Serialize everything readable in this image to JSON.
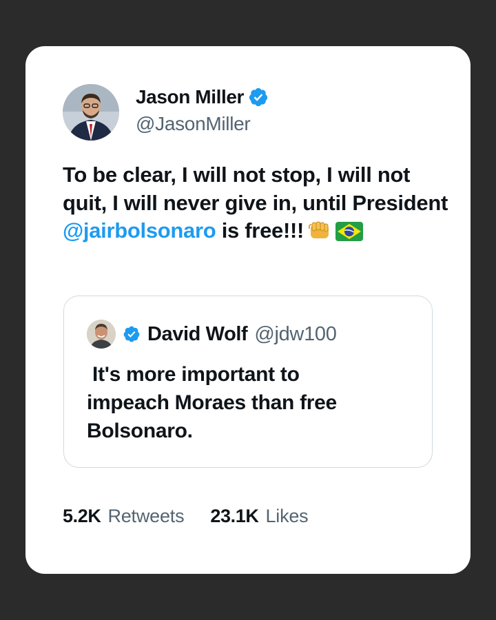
{
  "tweet": {
    "author_name": "Jason Miller",
    "author_handle": "@JasonMiller",
    "verified": true,
    "text_before": "To be clear, I will not stop, I will not quit, I will never give in, until President ",
    "mention": "@jairbolsonaro",
    "text_after": " is free!!!",
    "emojis": [
      "fist-icon",
      "brazil-flag-icon"
    ]
  },
  "quote": {
    "author_name": "David Wolf",
    "author_handle": "@jdw100",
    "verified": true,
    "text": " It's more important to\nimpeach Moraes than free\nBolsonaro."
  },
  "stats": {
    "retweets_count": "5.2K",
    "retweets_label": "Retweets",
    "likes_count": "23.1K",
    "likes_label": "Likes"
  },
  "colors": {
    "background": "#2b2b2b",
    "card": "#ffffff",
    "text": "#0f1419",
    "secondary": "#536471",
    "link": "#1d9bf0",
    "verified": "#1d9bf0"
  }
}
